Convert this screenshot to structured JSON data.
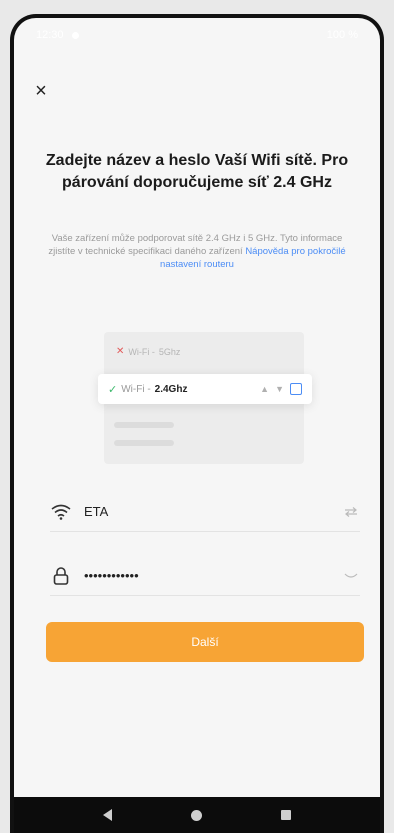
{
  "status_bar": {
    "time": "12:30",
    "right": "100 %"
  },
  "header": {
    "close_label": "×"
  },
  "title": "Zadejte název a heslo Vaší Wifi sítě. Pro párování doporučujeme síť 2.4 GHz",
  "description": {
    "text": "Vaše zařízení může podporovat sítě 2.4 GHz i 5 GHz. Tyto informace zjistíte v technické specifikaci daného zařízení ",
    "link": "Nápověda pro pokročilé nastavení routeru"
  },
  "illustration": {
    "top_row": {
      "prefix": "Wi-Fi -",
      "band": "5Ghz"
    },
    "card": {
      "prefix": "Wi-Fi -",
      "band": "2.4Ghz"
    }
  },
  "form": {
    "ssid": {
      "value": "ETA"
    },
    "password": {
      "value": "••••••••••••"
    }
  },
  "actions": {
    "next_label": "Další"
  },
  "colors": {
    "accent": "#f7a435",
    "link": "#4c8df5",
    "ok": "#3bb86b",
    "bad": "#e25a5a"
  }
}
